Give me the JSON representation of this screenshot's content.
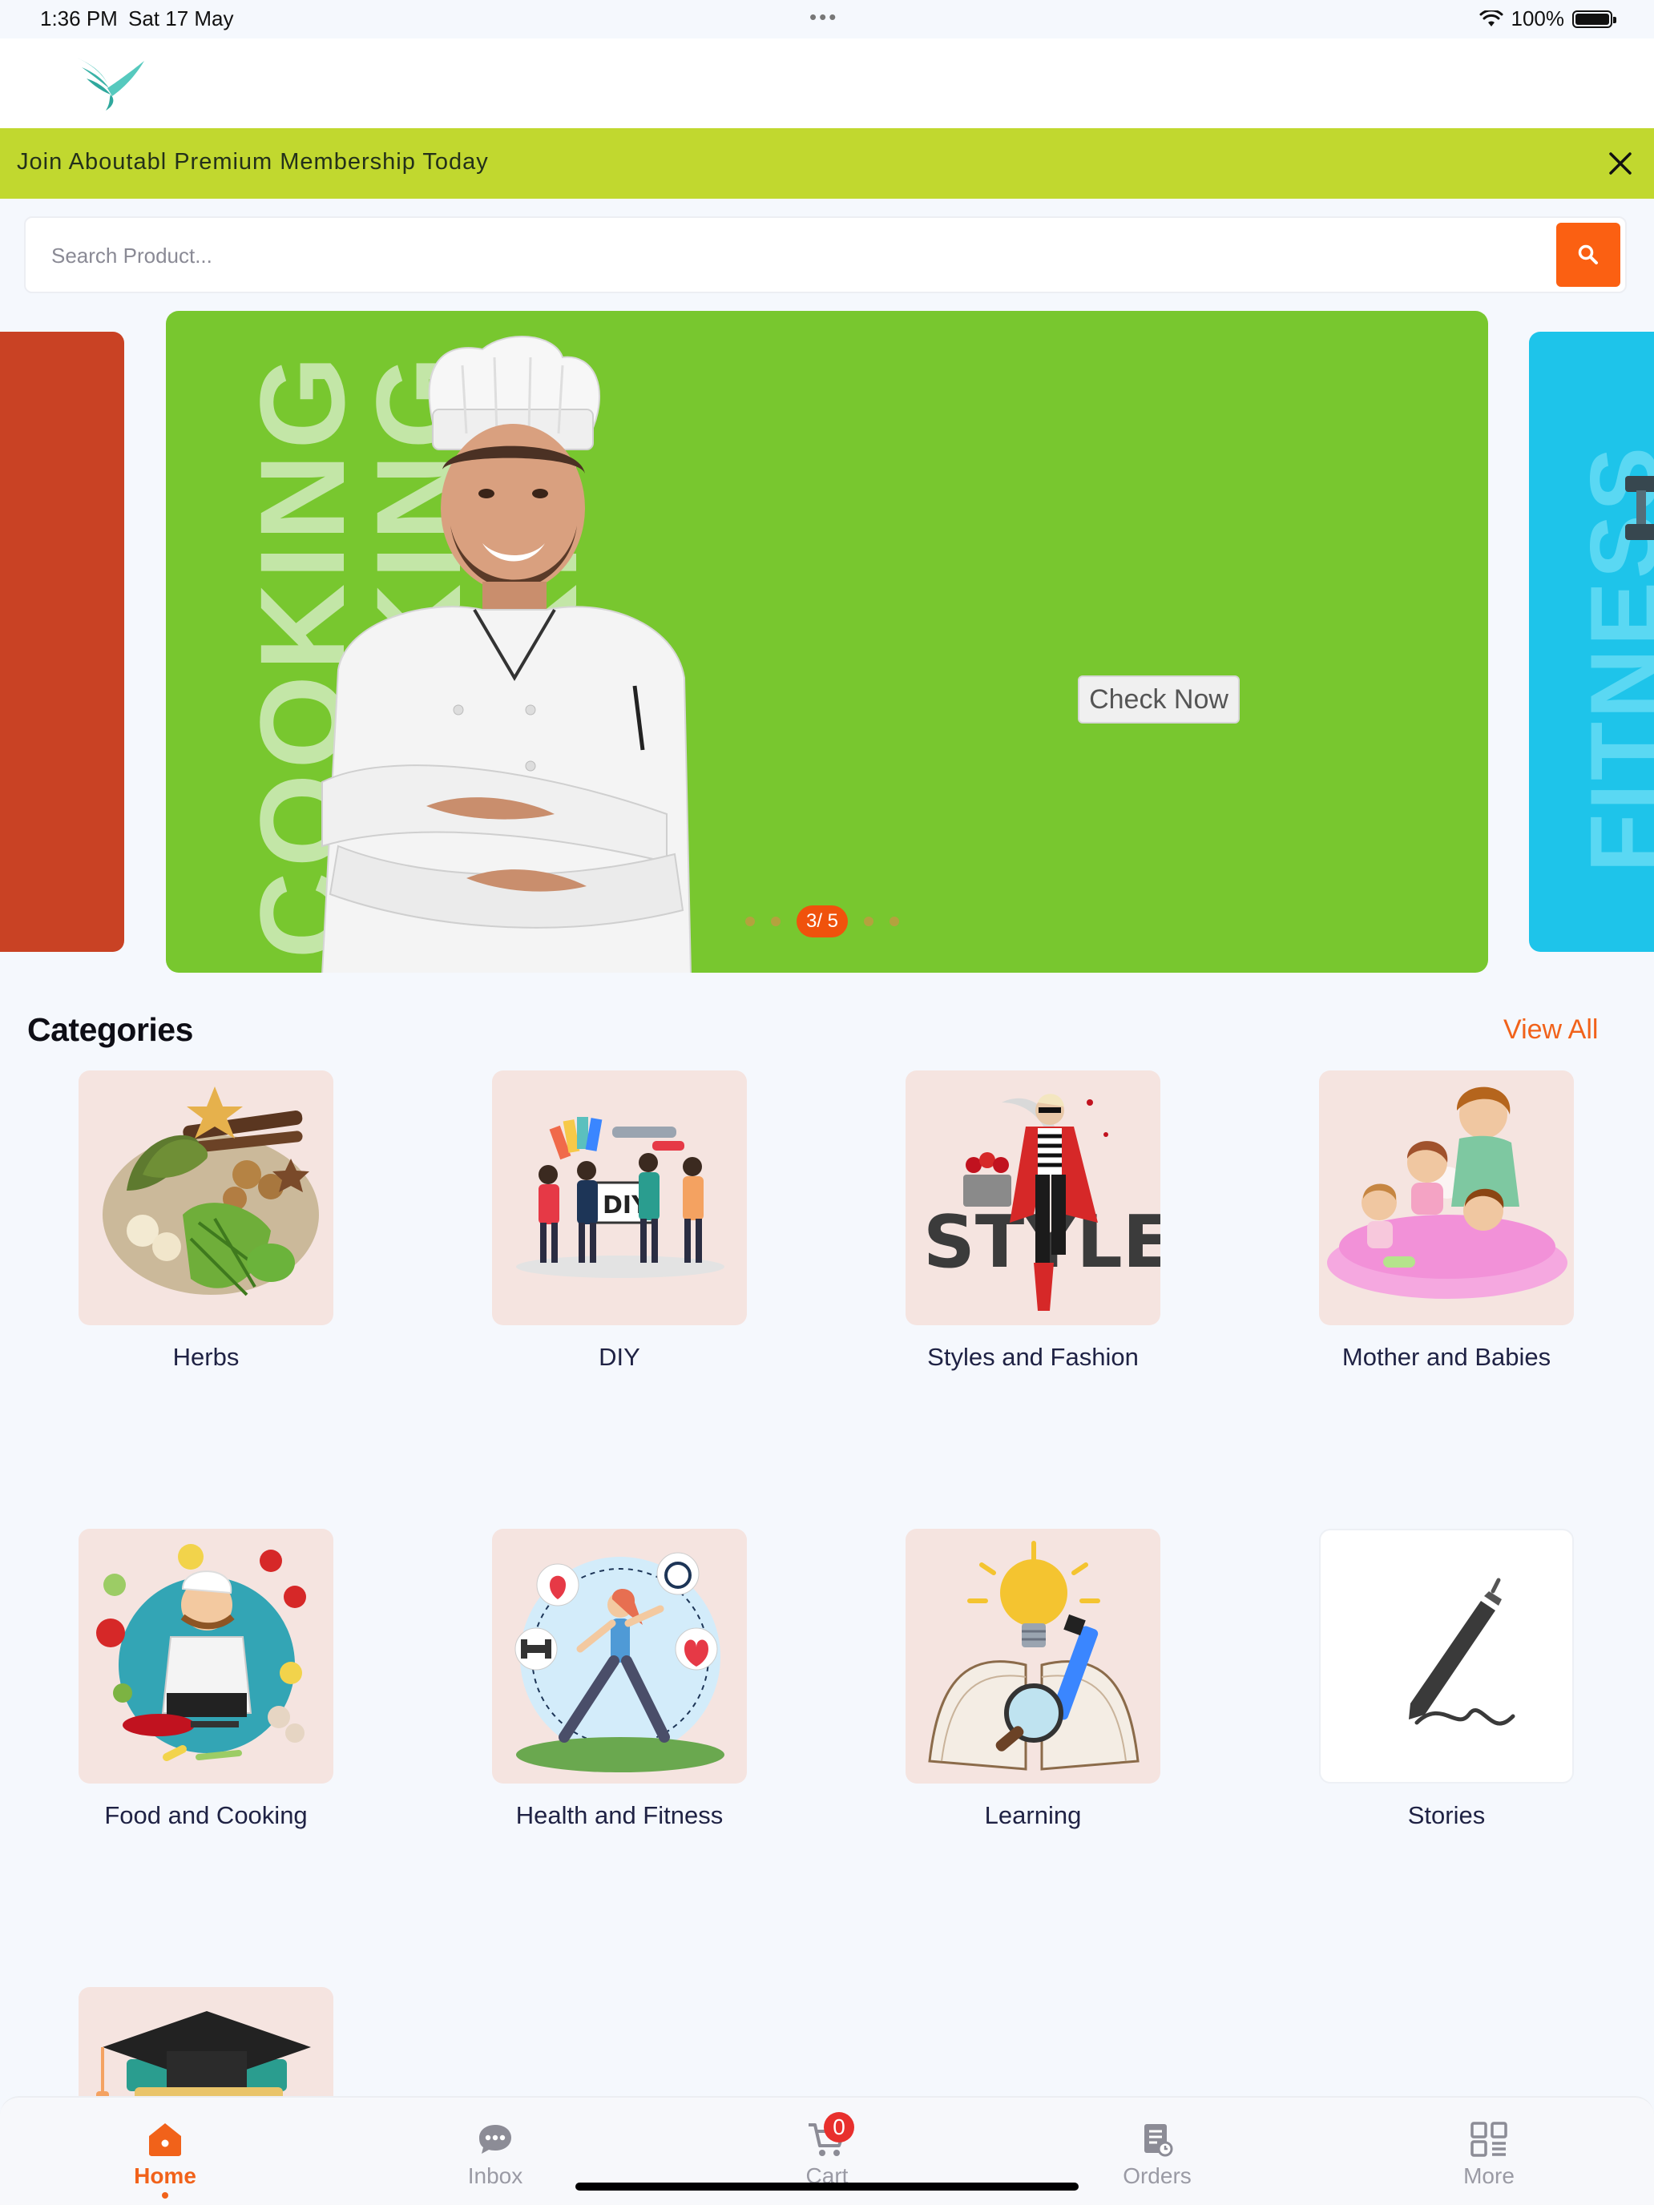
{
  "status_bar": {
    "time": "1:36 PM",
    "date": "Sat 17 May",
    "dots": "•••",
    "battery": "100%"
  },
  "promo": {
    "text": "Join Aboutabl Premium Membership Today"
  },
  "search": {
    "placeholder": "Search Product..."
  },
  "carousel": {
    "background_word": "COOKING",
    "right_slide_word": "FITNESS",
    "check_now_label": "Check Now",
    "page_indicator": "3/ 5",
    "colors": {
      "main": "#78c72f",
      "left": "#c94224",
      "right": "#1ec4ea"
    }
  },
  "categories": {
    "title": "Categories",
    "view_all_label": "View All",
    "items": [
      {
        "label": "Herbs",
        "icon": "herbs-illustration"
      },
      {
        "label": "DIY",
        "icon": "diy-illustration"
      },
      {
        "label": "Styles and Fashion",
        "icon": "fashion-illustration"
      },
      {
        "label": "Mother and Babies",
        "icon": "mother-babies-illustration"
      },
      {
        "label": "Food and Cooking",
        "icon": "chef-illustration"
      },
      {
        "label": "Health and Fitness",
        "icon": "fitness-illustration"
      },
      {
        "label": "Learning",
        "icon": "learning-illustration"
      },
      {
        "label": "Stories",
        "icon": "pen-icon"
      },
      {
        "label": "",
        "icon": "graduation-cap-illustration"
      }
    ]
  },
  "bottom_nav": {
    "items": [
      {
        "label": "Home",
        "icon": "home-icon",
        "active": true
      },
      {
        "label": "Inbox",
        "icon": "chat-icon"
      },
      {
        "label": "Cart",
        "icon": "cart-icon",
        "badge": "0"
      },
      {
        "label": "Orders",
        "icon": "orders-icon"
      },
      {
        "label": "More",
        "icon": "grid-icon"
      }
    ]
  },
  "accent_color": "#f1621a"
}
